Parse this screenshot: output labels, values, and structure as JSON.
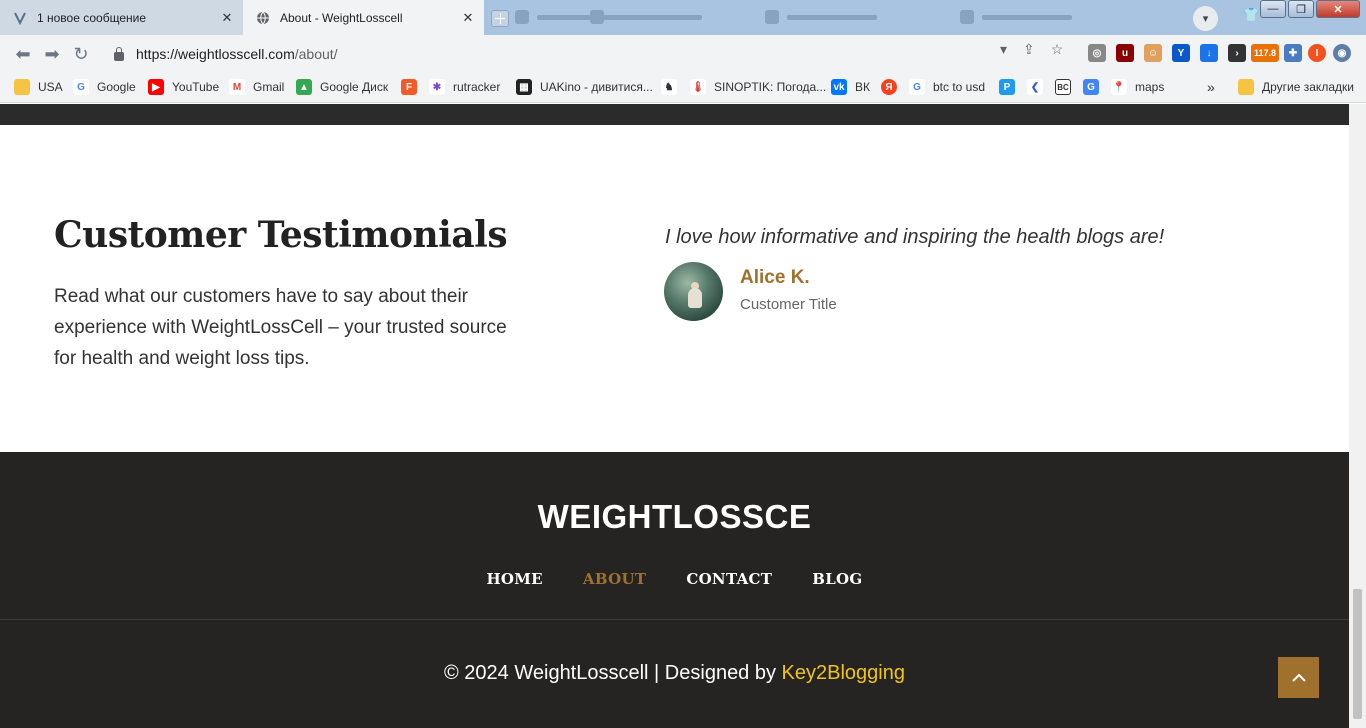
{
  "browser": {
    "tabs": [
      {
        "title": "1 новое сообщение",
        "active": false
      },
      {
        "title": "About - WeightLosscell",
        "active": true
      }
    ],
    "url_host": "https://weightlosscell.com",
    "url_path": "/about/",
    "bookmarks": [
      {
        "label": "USA",
        "icon": "folder-icon",
        "color": "#f6c343"
      },
      {
        "label": "Google",
        "icon": "google-icon",
        "color": "#4285f4"
      },
      {
        "label": "YouTube",
        "icon": "youtube-icon",
        "color": "#ff0000"
      },
      {
        "label": "Gmail",
        "icon": "gmail-icon",
        "color": "#ea4335"
      },
      {
        "label": "Google Диск",
        "icon": "drive-icon",
        "color": "#34a853"
      },
      {
        "label": "",
        "icon": "f-icon",
        "color": "#f25a29"
      },
      {
        "label": "rutracker",
        "icon": "rutracker-icon",
        "color": "#7b4bd6"
      },
      {
        "label": "UAKino - дивитися...",
        "icon": "uakino-icon",
        "color": "#222222"
      },
      {
        "label": "",
        "icon": "chess-icon",
        "color": "#333333"
      },
      {
        "label": "SINOPTIK: Погода...",
        "icon": "sinoptik-icon",
        "color": "#d33"
      },
      {
        "label": "ВК",
        "icon": "vk-icon",
        "color": "#0077ff"
      },
      {
        "label": "",
        "icon": "yandex-icon",
        "color": "#fc3f1d"
      },
      {
        "label": "btc to usd",
        "icon": "google-icon",
        "color": "#4285f4"
      },
      {
        "label": "",
        "icon": "p-icon",
        "color": "#1e9bf0"
      },
      {
        "label": "",
        "icon": "arrow-icon",
        "color": "#3b5bdb"
      },
      {
        "label": "",
        "icon": "bc-icon",
        "color": "#333333"
      },
      {
        "label": "",
        "icon": "translate-icon",
        "color": "#4285f4"
      },
      {
        "label": "maps",
        "icon": "maps-icon",
        "color": "#34a853"
      }
    ],
    "bookmarks_more": "»",
    "other_bookmarks": "Другие закладки",
    "badge_text": "117.8"
  },
  "testimonials": {
    "heading": "Customer Testimonials",
    "description": "Read what our customers have to say about their experience with WeightLossCell – your trusted source for health and weight loss tips.",
    "quote": "I love how informative and inspiring the health blogs are!",
    "author": "Alice K.",
    "author_title": "Customer Title"
  },
  "footer": {
    "brand": "WEIGHTLOSSCE",
    "nav": [
      "HOME",
      "ABOUT",
      "CONTACT",
      "BLOG"
    ],
    "active_nav": "ABOUT",
    "copyright": "© 2024 WeightLosscell | Designed by ",
    "designer": "Key2Blogging"
  },
  "colors": {
    "accent": "#a0712d",
    "footer_bg": "#262422",
    "designer_link": "#f0c419"
  }
}
